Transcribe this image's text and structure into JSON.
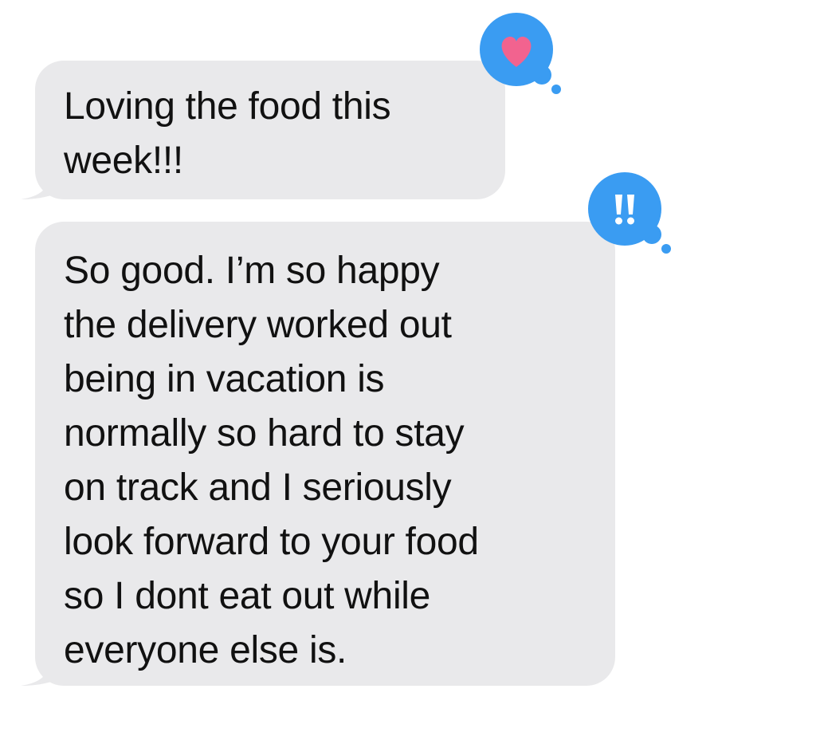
{
  "conversation": {
    "messages": [
      {
        "text": "Loving the food this\nweek!!!",
        "reaction": "heart-icon"
      },
      {
        "text": "So good. I’m so happy\nthe delivery worked out\nbeing in vacation is\nnormally so hard to stay\non track and I seriously\nlook forward to your food\nso I dont eat out while\neveryone else is.",
        "reaction": "double-exclamation-icon"
      }
    ]
  },
  "colors": {
    "bubble_received": "#e9e9eb",
    "tapback_blue": "#3a9cf2",
    "heart_pink": "#f2638f",
    "text": "#111111"
  }
}
